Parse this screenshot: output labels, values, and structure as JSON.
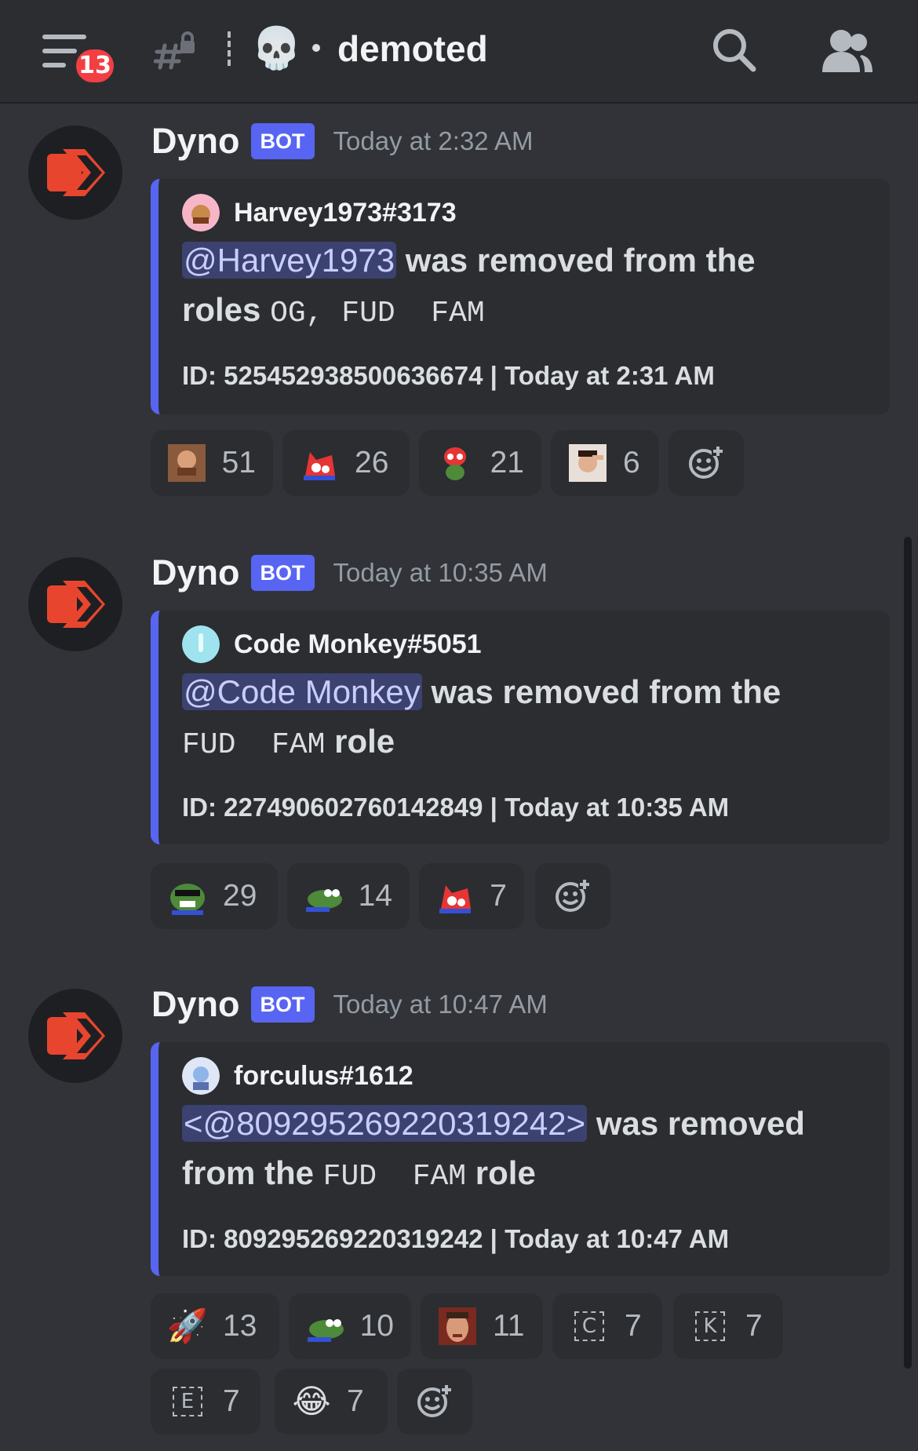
{
  "header": {
    "unread_count": "13",
    "channel_emoji": "💀",
    "channel_name": "demoted",
    "icons": [
      "hamburger-menu-icon",
      "thread-lock-icon",
      "search-icon",
      "members-icon"
    ]
  },
  "messages": [
    {
      "author": "Dyno",
      "bot_tag": "BOT",
      "timestamp": "Today at 2:32 AM",
      "embed": {
        "author_name": "Harvey1973#3173",
        "mention": "@Harvey1973",
        "text_after_mention": " was removed from the",
        "line2_prefix": "roles ",
        "roles": "OG, FUD  FAM",
        "footer": "ID: 525452938500636674 | Today at 2:31 AM"
      },
      "reactions": [
        {
          "emoji": "laughing-man-emoji",
          "count": "51"
        },
        {
          "emoji": "red-bird-emoji",
          "count": "26"
        },
        {
          "emoji": "red-frog-emoji",
          "count": "21"
        },
        {
          "emoji": "salute-man-emoji",
          "count": "6"
        }
      ]
    },
    {
      "author": "Dyno",
      "bot_tag": "BOT",
      "timestamp": "Today at 10:35 AM",
      "embed": {
        "author_name": "Code Monkey#5051",
        "mention": "@Code Monkey",
        "text_after_mention": " was removed from the",
        "roles": "FUD  FAM",
        "line2_suffix": " role",
        "footer": "ID: 227490602760142849 | Today at 10:35 AM"
      },
      "reactions": [
        {
          "emoji": "pepe-sunglasses-emoji",
          "count": "29"
        },
        {
          "emoji": "pepe-lying-emoji",
          "count": "14"
        },
        {
          "emoji": "red-bird-emoji",
          "count": "7"
        }
      ]
    },
    {
      "author": "Dyno",
      "bot_tag": "BOT",
      "timestamp": "Today at 10:47 AM",
      "embed": {
        "author_name": "forculus#1612",
        "mention": "<@809295269220319242>",
        "text_after_mention": " was removed",
        "line2_prefix": "from the ",
        "roles": "FUD  FAM",
        "line2_suffix": " role",
        "footer": "ID: 809295269220319242 | Today at 10:47 AM"
      },
      "reactions": [
        {
          "emoji": "🚀",
          "count": "13"
        },
        {
          "emoji": "pepe-lying-emoji",
          "count": "10"
        },
        {
          "emoji": "man-face-emoji",
          "count": "11"
        },
        {
          "emoji": "C",
          "count": "7"
        },
        {
          "emoji": "K",
          "count": "7"
        },
        {
          "emoji": "E",
          "count": "7"
        },
        {
          "emoji": "😂",
          "count": "7"
        }
      ]
    }
  ]
}
